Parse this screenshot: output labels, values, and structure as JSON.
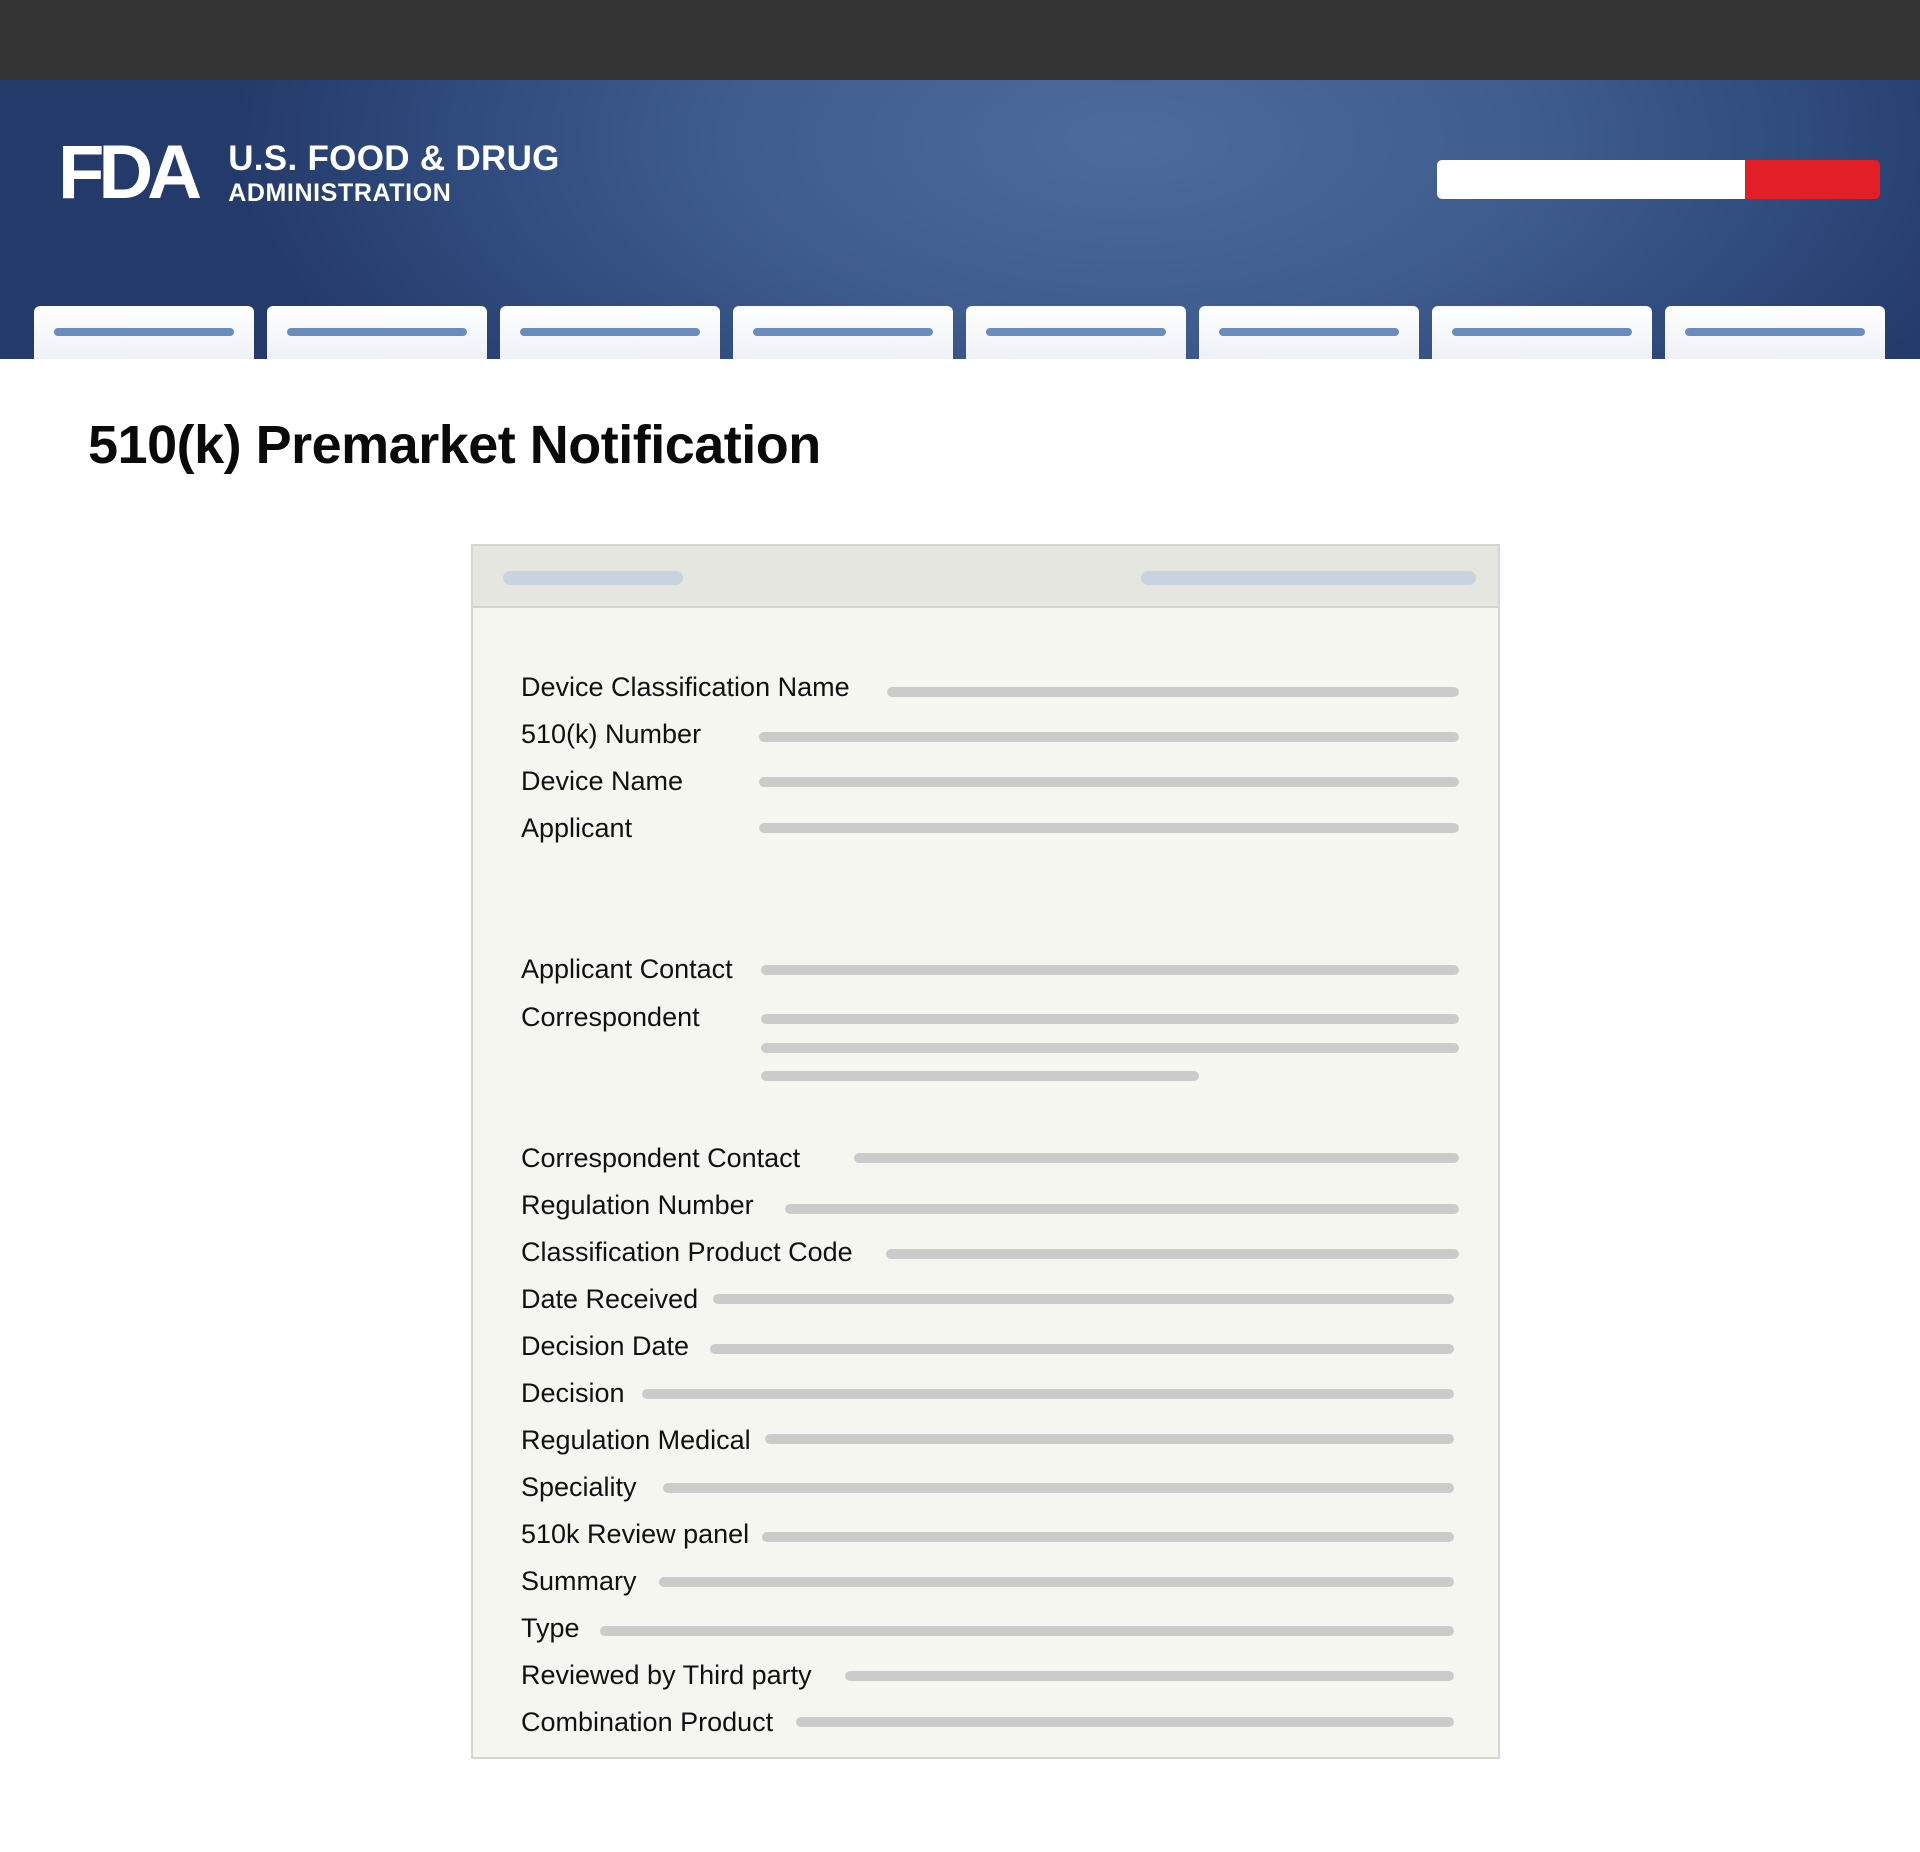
{
  "header": {
    "logo_mark": "FDA",
    "logo_line1": "U.S. FOOD & DRUG",
    "logo_line2": "ADMINISTRATION"
  },
  "colors": {
    "topbar": "#333333",
    "header_blue": "#3f5c8f",
    "search_button": "#e21f26",
    "nav_placeholder": "#6a8dbe",
    "card_background": "#f6f6f1",
    "value_placeholder": "#cbcbcb"
  },
  "page": {
    "title": "510(k) Premarket Notification"
  },
  "record": {
    "fields": [
      {
        "label": "Device Classification Name"
      },
      {
        "label": "510(k) Number"
      },
      {
        "label": "Device Name"
      },
      {
        "label": "Applicant"
      },
      {
        "label": "Applicant Contact"
      },
      {
        "label": "Correspondent"
      },
      {
        "label": "Correspondent Contact"
      },
      {
        "label": "Regulation Number"
      },
      {
        "label": "Classification Product Code"
      },
      {
        "label": "Date Received"
      },
      {
        "label": "Decision Date"
      },
      {
        "label": "Decision"
      },
      {
        "label": "Regulation Medical"
      },
      {
        "label": "Speciality"
      },
      {
        "label": "510k Review panel"
      },
      {
        "label": "Summary"
      },
      {
        "label": "Type"
      },
      {
        "label": "Reviewed by Third party"
      },
      {
        "label": "Combination Product"
      }
    ]
  }
}
